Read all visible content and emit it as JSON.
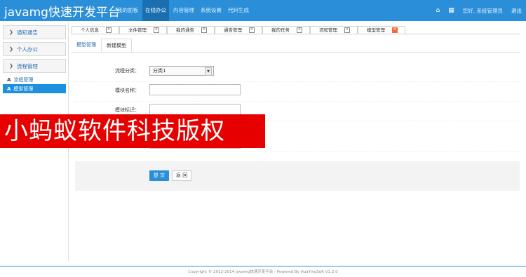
{
  "app": {
    "title": "javamg快速开发平台"
  },
  "topnav": [
    {
      "label": "我的面板",
      "active": false
    },
    {
      "label": "在线办公",
      "active": true
    },
    {
      "label": "内容管理",
      "active": false
    },
    {
      "label": "系统设置",
      "active": false
    },
    {
      "label": "代码生成",
      "active": false
    }
  ],
  "topright": {
    "home_icon": "home-icon",
    "menu_icon": "grid-icon",
    "greeting": "您好, 系统管理员",
    "logout": "退出"
  },
  "sidebar": {
    "groups": [
      {
        "label": "通知通告",
        "expanded": false
      },
      {
        "label": "个人办公",
        "expanded": false
      },
      {
        "label": "流程管理",
        "expanded": true
      }
    ],
    "subitems": [
      {
        "label": "流程管理",
        "icon": "flow-icon",
        "active": false
      },
      {
        "label": "模型管理",
        "icon": "model-icon",
        "active": true
      }
    ]
  },
  "tabs": [
    {
      "label": "个人信息",
      "active": false
    },
    {
      "label": "文件管理",
      "active": false
    },
    {
      "label": "我的通告",
      "active": false
    },
    {
      "label": "通告管理",
      "active": false
    },
    {
      "label": "我的任务",
      "active": false
    },
    {
      "label": "流程管理",
      "active": false
    },
    {
      "label": "模型管理",
      "active": true
    }
  ],
  "subtabs": [
    {
      "label": "模型管理",
      "active": false
    },
    {
      "label": "新建模型",
      "active": true
    }
  ],
  "form": {
    "category_label": "流程分类：",
    "category_value": "分类1",
    "name_label": "模块名称：",
    "key_label": "模块标识："
  },
  "actions": {
    "submit": "提 交",
    "back": "返 回"
  },
  "watermark": "小蚂蚁软件科技版权",
  "footer": "Copyright © 2012-2014 javamg快速开发平台 - Powered By HuaYingSoft V1.2.0",
  "colors": {
    "primary": "#2a8fd8",
    "watermark": "#e60000",
    "close_active": "#f26b3a"
  }
}
